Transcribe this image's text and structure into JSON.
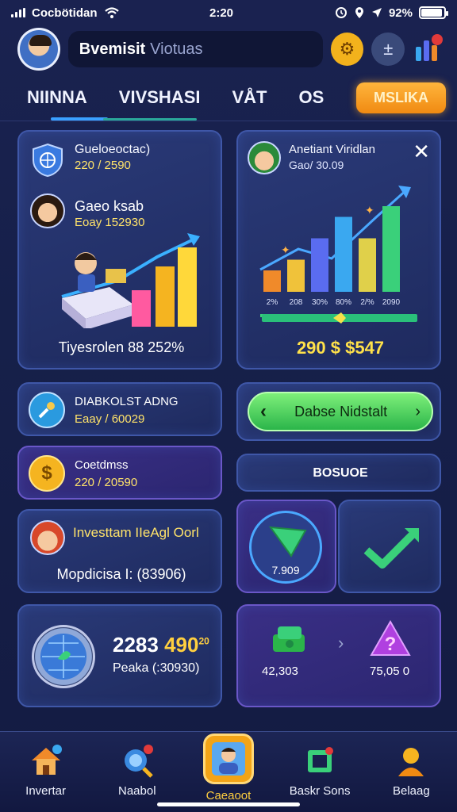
{
  "status_bar": {
    "carrier": "Cocbötidan",
    "time": "2:20",
    "battery": "92%",
    "battery_level": 0.92
  },
  "header": {
    "search_text": "Bvemisit",
    "search_placeholder": "Viotuas"
  },
  "tabs": [
    {
      "label": "NIINNA"
    },
    {
      "label": "VIVSHASI"
    },
    {
      "label": "VÅT"
    },
    {
      "label": "OS"
    }
  ],
  "tab_cta": "MSLIKA",
  "cards": {
    "portfolio": {
      "title": "Gueloeoctac)",
      "sub": "220 / 2590",
      "person_title": "Gaeo ksab",
      "person_sub": "Eoay 152930",
      "footer": "Tiyesrolen 88 252%"
    },
    "analytics": {
      "title": "Anetiant Viridlan",
      "sub": "Gao/ 30.09",
      "x_labels": [
        "2%",
        "208",
        "30%",
        "80%",
        "2/%",
        "2090"
      ],
      "total": "290 $ $547"
    },
    "diagnostic": {
      "title": "DIABKOLST ADNG",
      "sub": "Eaay / 60029"
    },
    "balance_button": "Dabse Nidstalt",
    "coins": {
      "title": "Coetdmss",
      "sub": "220 / 20590"
    },
    "bosuoe": "BOSUOE",
    "investment": {
      "title": "Investtam IIeAgl Oorl",
      "sub": "Mopdicisa I: (83906)"
    },
    "up_badge_value": "7.909",
    "global": {
      "value": "2283",
      "value_accent": "490",
      "superscript": "20",
      "sub": "Peaka (:30930)"
    },
    "stats": {
      "left": "42,303",
      "right": "75,05 0"
    }
  },
  "chart_data": {
    "type": "bar",
    "categories": [
      "2%",
      "208",
      "30%",
      "80%",
      "2/%",
      "2090"
    ],
    "values": [
      2,
      3,
      5,
      7,
      5,
      8
    ],
    "title": "",
    "xlabel": "",
    "ylabel": "",
    "colors": [
      "#f08a2a",
      "#f0c23a",
      "#5a6cf0",
      "#3aa8f0",
      "#e0d04a",
      "#3ad07a"
    ]
  },
  "nav": [
    {
      "label": "Invertar",
      "icon": "home-icon"
    },
    {
      "label": "Naabol",
      "icon": "search-icon"
    },
    {
      "label": "Caeaoot",
      "icon": "profile-icon"
    },
    {
      "label": "Baskr Sons",
      "icon": "refresh-icon"
    },
    {
      "label": "Belaag",
      "icon": "user-icon"
    }
  ],
  "colors": {
    "accent": "#f3a417",
    "highlight": "#ffe14a",
    "positive": "#3ad07a",
    "card_border": "#3f57a8"
  }
}
